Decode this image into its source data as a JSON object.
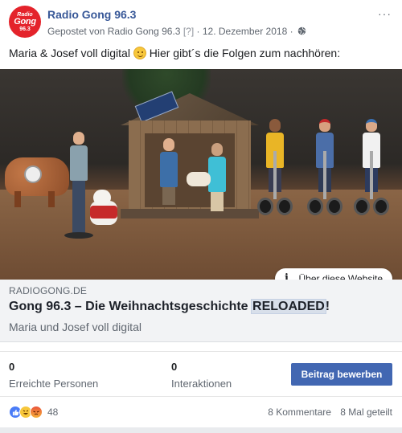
{
  "header": {
    "page_name": "Radio Gong 96.3",
    "logo_text": [
      "Radio",
      "Gong",
      "96.3"
    ],
    "posted_by_prefix": "Gepostet von",
    "posted_by": "Radio Gong 96.3",
    "help_marker": "[?]",
    "separator": "·",
    "date": "12. Dezember 2018",
    "audience_icon": "globe-icon",
    "more_label": "···"
  },
  "post": {
    "text_before_emoji": "Maria & Josef voll digital",
    "emoji": "smile-icon",
    "text_after_emoji": "Hier gibt´s die Folgen zum nachhören:"
  },
  "media": {
    "info_label": "Über diese Website",
    "info_icon": "info-icon"
  },
  "link_preview": {
    "domain": "RADIOGONG.DE",
    "title_prefix": "Gong 96.3 – Die Weihnachtsgeschichte ",
    "title_highlight": "RELOADED",
    "title_suffix": "!",
    "description": "Maria und Josef voll digital"
  },
  "stats": {
    "reached_value": "0",
    "reached_label": "Erreichte Personen",
    "interactions_value": "0",
    "interactions_label": "Interaktionen",
    "boost_label": "Beitrag bewerben"
  },
  "footer": {
    "reaction_icons": [
      "like-icon",
      "haha-icon",
      "angry-icon"
    ],
    "reaction_count": "48",
    "comments": "8 Kommentare",
    "shares": "8 Mal geteilt"
  },
  "colors": {
    "brand_link": "#385898",
    "boost_button": "#4267b2",
    "logo_red": "#e4232b"
  }
}
